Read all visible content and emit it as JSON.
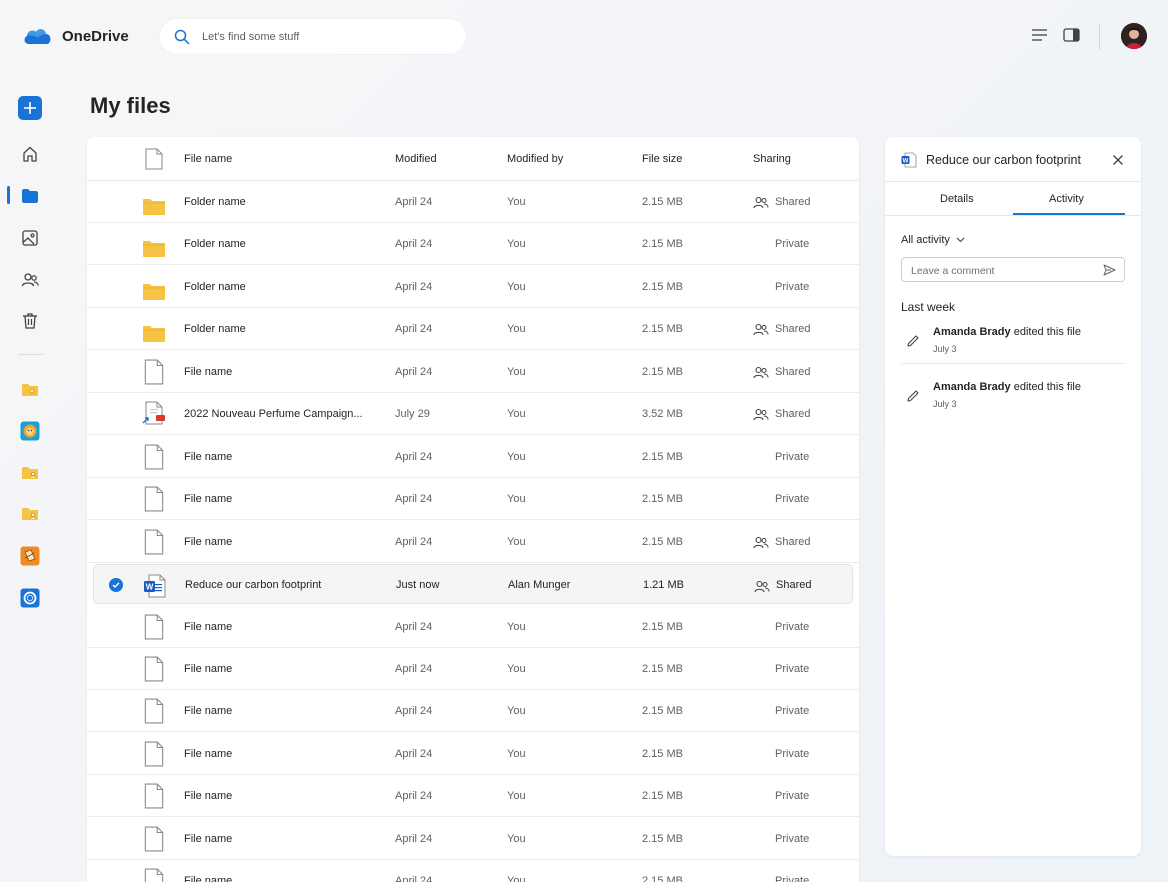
{
  "app": {
    "name": "OneDrive"
  },
  "search": {
    "placeholder": "Let's find some stuff"
  },
  "page": {
    "title": "My files"
  },
  "columns": {
    "name": "File name",
    "modified": "Modified",
    "modified_by": "Modified by",
    "size": "File size",
    "sharing": "Sharing"
  },
  "rows": [
    {
      "type": "folder",
      "name": "Folder name",
      "modified": "April 24",
      "by": "You",
      "size": "2.15 MB",
      "sharing": "Shared"
    },
    {
      "type": "folder",
      "name": "Folder name",
      "modified": "April 24",
      "by": "You",
      "size": "2.15 MB",
      "sharing": "Private"
    },
    {
      "type": "folder",
      "name": "Folder name",
      "modified": "April 24",
      "by": "You",
      "size": "2.15 MB",
      "sharing": "Private"
    },
    {
      "type": "folder",
      "name": "Folder name",
      "modified": "April 24",
      "by": "You",
      "size": "2.15 MB",
      "sharing": "Shared"
    },
    {
      "type": "file",
      "name": "File name",
      "modified": "April 24",
      "by": "You",
      "size": "2.15 MB",
      "sharing": "Shared"
    },
    {
      "type": "pdf",
      "name": "2022 Nouveau Perfume Campaign...",
      "modified": "July 29",
      "by": "You",
      "size": "3.52 MB",
      "sharing": "Shared"
    },
    {
      "type": "file",
      "name": "File name",
      "modified": "April 24",
      "by": "You",
      "size": "2.15 MB",
      "sharing": "Private"
    },
    {
      "type": "file",
      "name": "File name",
      "modified": "April 24",
      "by": "You",
      "size": "2.15 MB",
      "sharing": "Private"
    },
    {
      "type": "file",
      "name": "File name",
      "modified": "April 24",
      "by": "You",
      "size": "2.15 MB",
      "sharing": "Shared"
    },
    {
      "type": "word",
      "name": "Reduce our carbon footprint",
      "modified": "Just now",
      "by": "Alan Munger",
      "size": "1.21 MB",
      "sharing": "Shared",
      "selected": true
    },
    {
      "type": "file",
      "name": "File name",
      "modified": "April 24",
      "by": "You",
      "size": "2.15 MB",
      "sharing": "Private"
    },
    {
      "type": "file",
      "name": "File name",
      "modified": "April 24",
      "by": "You",
      "size": "2.15 MB",
      "sharing": "Private"
    },
    {
      "type": "file",
      "name": "File name",
      "modified": "April 24",
      "by": "You",
      "size": "2.15 MB",
      "sharing": "Private"
    },
    {
      "type": "file",
      "name": "File name",
      "modified": "April 24",
      "by": "You",
      "size": "2.15 MB",
      "sharing": "Private"
    },
    {
      "type": "file",
      "name": "File name",
      "modified": "April 24",
      "by": "You",
      "size": "2.15 MB",
      "sharing": "Private"
    },
    {
      "type": "file",
      "name": "File name",
      "modified": "April 24",
      "by": "You",
      "size": "2.15 MB",
      "sharing": "Private"
    },
    {
      "type": "file",
      "name": "File name",
      "modified": "April 24",
      "by": "You",
      "size": "2.15 MB",
      "sharing": "Private"
    }
  ],
  "panel": {
    "title": "Reduce our carbon footprint",
    "tabs": [
      "Details",
      "Activity"
    ],
    "active_tab": "Activity",
    "filter": "All activity",
    "comment_placeholder": "Leave a comment",
    "section": "Last week",
    "activities": [
      {
        "user": "Amanda Brady",
        "action": "edited this file",
        "date": "July 3"
      },
      {
        "user": "Amanda Brady",
        "action": "edited this file",
        "date": "July 3"
      }
    ]
  },
  "colors": {
    "accent": "#1a73d6",
    "folder": "#f6c445"
  }
}
